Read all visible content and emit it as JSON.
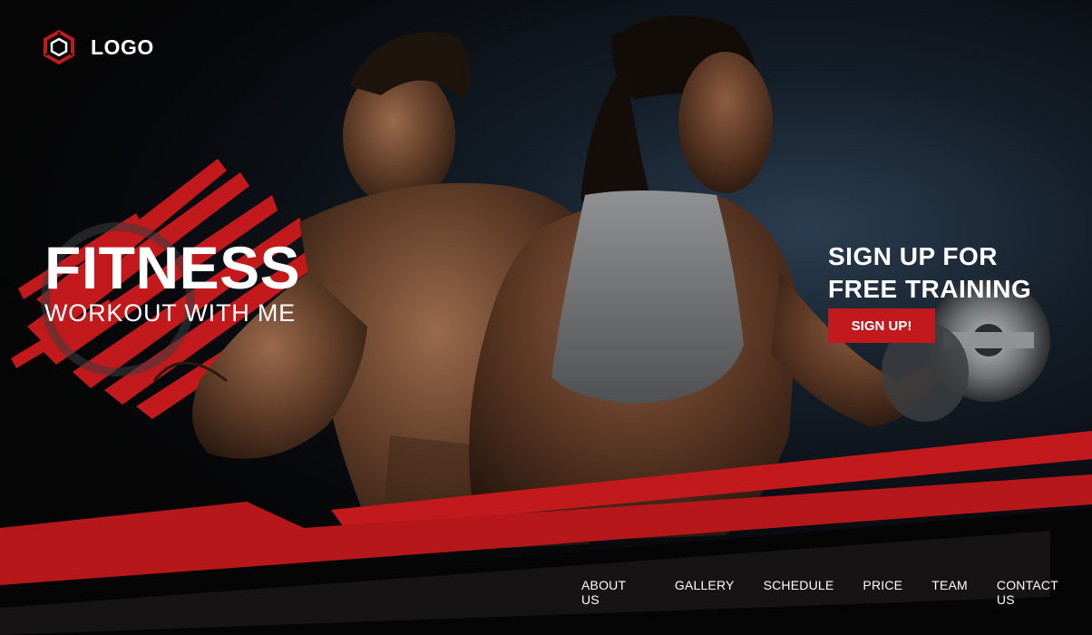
{
  "brand": {
    "logo_text": "LOGO",
    "logo_icon": "hexagon-logo-icon",
    "accent_color": "#c1191c"
  },
  "hero": {
    "title": "FITNESS",
    "subtitle": "WORKOUT WITH ME"
  },
  "cta": {
    "heading_line1": "SIGN UP FOR",
    "heading_line2": "FREE TRAINING",
    "button_label": "SIGN UP!"
  },
  "nav": {
    "items": [
      {
        "label": "ABOUT US"
      },
      {
        "label": "GALLERY"
      },
      {
        "label": "SCHEDULE"
      },
      {
        "label": "PRICE"
      },
      {
        "label": "TEAM"
      },
      {
        "label": "CONTACT US"
      }
    ]
  }
}
